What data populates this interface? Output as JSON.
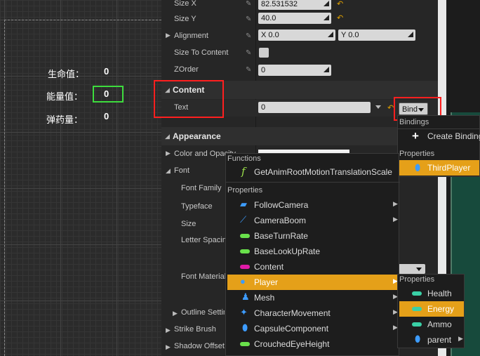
{
  "canvas": {
    "hud": {
      "health_label": "生命值：",
      "health_value": "0",
      "energy_label": "能量值：",
      "energy_value": "0",
      "ammo_label": "弹药量：",
      "ammo_value": "0"
    }
  },
  "details": {
    "size_x": {
      "label": "Size X",
      "value": "82.531532"
    },
    "size_y": {
      "label": "Size Y",
      "value": "40.0"
    },
    "alignment": {
      "label": "Alignment",
      "x": "X  0.0",
      "y": "Y  0.0"
    },
    "size_to_content": {
      "label": "Size To Content"
    },
    "zorder": {
      "label": "ZOrder",
      "value": "0"
    },
    "content_category": "Content",
    "text": {
      "label": "Text",
      "value": "0"
    },
    "bind_button": "Bind",
    "appearance_category": "Appearance",
    "color_opacity": {
      "label": "Color and Opacity"
    },
    "font": {
      "label": "Font"
    },
    "font_family": "Font Family",
    "typeface": "Typeface",
    "size": "Size",
    "letter_spacing": "Letter Spacing",
    "font_material": "Font Material",
    "outline_settings": "Outline Settings",
    "strike_brush": "Strike Brush",
    "shadow_offset": "Shadow Offset"
  },
  "bindings_menu": {
    "bindings_header": "Bindings",
    "create_binding": "Create Binding",
    "properties_header": "Properties",
    "third_player": "ThirdPlayer"
  },
  "functions_menu": {
    "functions_header": "Functions",
    "function_item": "GetAnimRootMotionTranslationScale",
    "properties_header": "Properties",
    "items": [
      {
        "label": "FollowCamera",
        "icon": "camera-icon",
        "submenu": true
      },
      {
        "label": "CameraBoom",
        "icon": "spring-arm-icon",
        "submenu": true
      },
      {
        "label": "BaseTurnRate",
        "icon": "float-icon",
        "submenu": false
      },
      {
        "label": "BaseLookUpRate",
        "icon": "float-icon",
        "submenu": false
      },
      {
        "label": "Content",
        "icon": "text-icon",
        "submenu": false
      },
      {
        "label": "Player",
        "icon": "object-icon",
        "submenu": true,
        "selected": true
      },
      {
        "label": "Mesh",
        "icon": "mesh-icon",
        "submenu": true
      },
      {
        "label": "CharacterMovement",
        "icon": "movement-icon",
        "submenu": true
      },
      {
        "label": "CapsuleComponent",
        "icon": "capsule-icon",
        "submenu": true
      },
      {
        "label": "CrouchedEyeHeight",
        "icon": "float-icon",
        "submenu": false
      }
    ]
  },
  "player_menu": {
    "properties_header": "Properties",
    "items": [
      {
        "label": "Health",
        "selected": false
      },
      {
        "label": "Energy",
        "selected": true
      },
      {
        "label": "Ammo",
        "selected": false
      },
      {
        "label": "parent",
        "submenu": true
      }
    ]
  },
  "colors": {
    "highlight": "#e5a019",
    "red_annotation": "#ff1f1f",
    "hud_box": "#3ddc3d"
  }
}
